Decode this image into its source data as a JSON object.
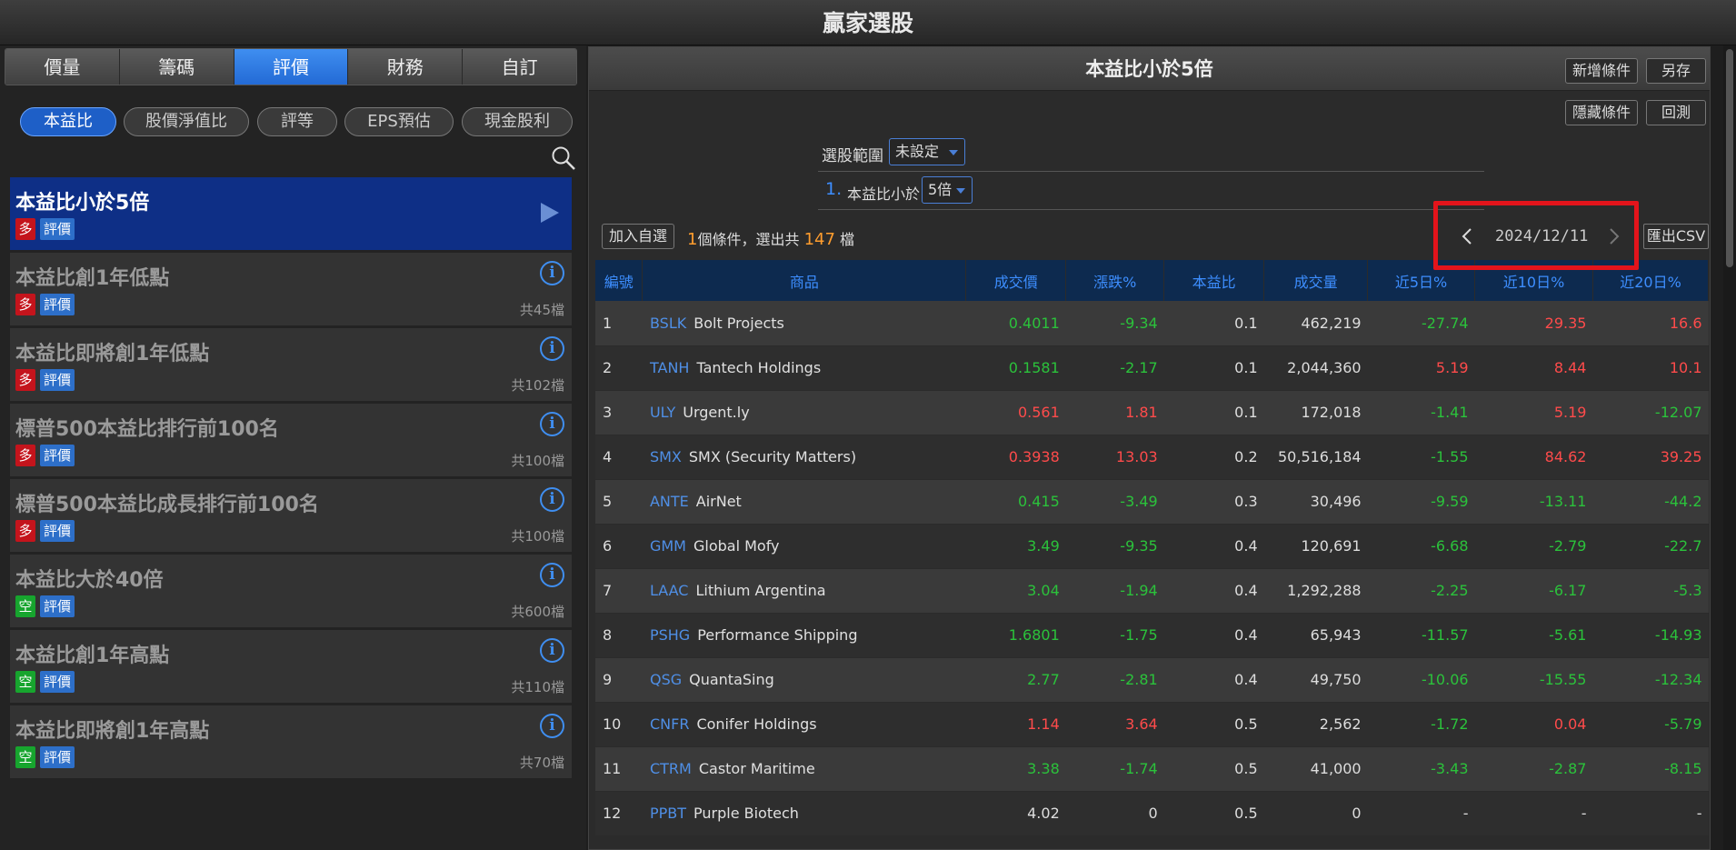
{
  "window": {
    "title": "贏家選股"
  },
  "tabs": [
    "價量",
    "籌碼",
    "評價",
    "財務",
    "自訂"
  ],
  "subtabs": [
    "本益比",
    "股價淨值比",
    "評等",
    "EPS預估",
    "現金股利"
  ],
  "items": [
    {
      "title": "本益比小於5倍",
      "b1": "多",
      "b2": "評價",
      "count": ""
    },
    {
      "title": "本益比創1年低點",
      "b1": "多",
      "b2": "評價",
      "count": "共45檔"
    },
    {
      "title": "本益比即將創1年低點",
      "b1": "多",
      "b2": "評價",
      "count": "共102檔"
    },
    {
      "title": "標普500本益比排行前100名",
      "b1": "多",
      "b2": "評價",
      "count": "共100檔"
    },
    {
      "title": "標普500本益比成長排行前100名",
      "b1": "多",
      "b2": "評價",
      "count": "共100檔"
    },
    {
      "title": "本益比大於40倍",
      "b1": "空",
      "b2": "評價",
      "count": "共600檔"
    },
    {
      "title": "本益比創1年高點",
      "b1": "空",
      "b2": "評價",
      "count": "共110檔"
    },
    {
      "title": "本益比即將創1年高點",
      "b1": "空",
      "b2": "評價",
      "count": "共70檔"
    }
  ],
  "info_glyph": "i",
  "panel": {
    "title": "本益比小於5倍",
    "btn_add": "新增條件",
    "btn_save": "另存",
    "btn_hide": "隱藏條件",
    "btn_back": "回測",
    "scope_label": "選股範圍",
    "scope_value": "未設定",
    "cond_num": "1.",
    "cond_label": "本益比小於",
    "cond_value": "5倍",
    "add_watch": "加入自選",
    "cond_count": "1",
    "summary_mid": "個條件，選出共",
    "total": "147",
    "summary_unit": "檔",
    "date": "2024/12/11",
    "export": "匯出CSV"
  },
  "table": {
    "headers": [
      "編號",
      "商品",
      "成交價",
      "漲跌%",
      "本益比",
      "成交量",
      "近5日%",
      "近10日%",
      "近20日%"
    ],
    "rows": [
      [
        "1",
        "BSLK",
        "Bolt Projects",
        "0.4011",
        "-9.34",
        "0.1",
        "462,219",
        "-27.74",
        "29.35",
        "16.6"
      ],
      [
        "2",
        "TANH",
        "Tantech Holdings",
        "0.1581",
        "-2.17",
        "0.1",
        "2,044,360",
        "5.19",
        "8.44",
        "10.1"
      ],
      [
        "3",
        "ULY",
        "Urgent.ly",
        "0.561",
        "1.81",
        "0.1",
        "172,018",
        "-1.41",
        "5.19",
        "-12.07"
      ],
      [
        "4",
        "SMX",
        "SMX (Security Matters)",
        "0.3938",
        "13.03",
        "0.2",
        "50,516,184",
        "-1.55",
        "84.62",
        "39.25"
      ],
      [
        "5",
        "ANTE",
        "AirNet",
        "0.415",
        "-3.49",
        "0.3",
        "30,496",
        "-9.59",
        "-13.11",
        "-44.2"
      ],
      [
        "6",
        "GMM",
        "Global Mofy",
        "3.49",
        "-9.35",
        "0.4",
        "120,691",
        "-6.68",
        "-2.79",
        "-22.7"
      ],
      [
        "7",
        "LAAC",
        "Lithium Argentina",
        "3.04",
        "-1.94",
        "0.4",
        "1,292,288",
        "-2.25",
        "-6.17",
        "-5.3"
      ],
      [
        "8",
        "PSHG",
        "Performance Shipping",
        "1.6801",
        "-1.75",
        "0.4",
        "65,943",
        "-11.57",
        "-5.61",
        "-14.93"
      ],
      [
        "9",
        "QSG",
        "QuantaSing",
        "2.77",
        "-2.81",
        "0.4",
        "49,750",
        "-10.06",
        "-15.55",
        "-12.34"
      ],
      [
        "10",
        "CNFR",
        "Conifer Holdings",
        "1.14",
        "3.64",
        "0.5",
        "2,562",
        "-1.72",
        "0.04",
        "-5.79"
      ],
      [
        "11",
        "CTRM",
        "Castor Maritime",
        "3.38",
        "-1.74",
        "0.5",
        "41,000",
        "-3.43",
        "-2.87",
        "-8.15"
      ],
      [
        "12",
        "PPBT",
        "Purple Biotech",
        "4.02",
        "0",
        "0.5",
        "0",
        "-",
        "-",
        "-"
      ]
    ]
  }
}
